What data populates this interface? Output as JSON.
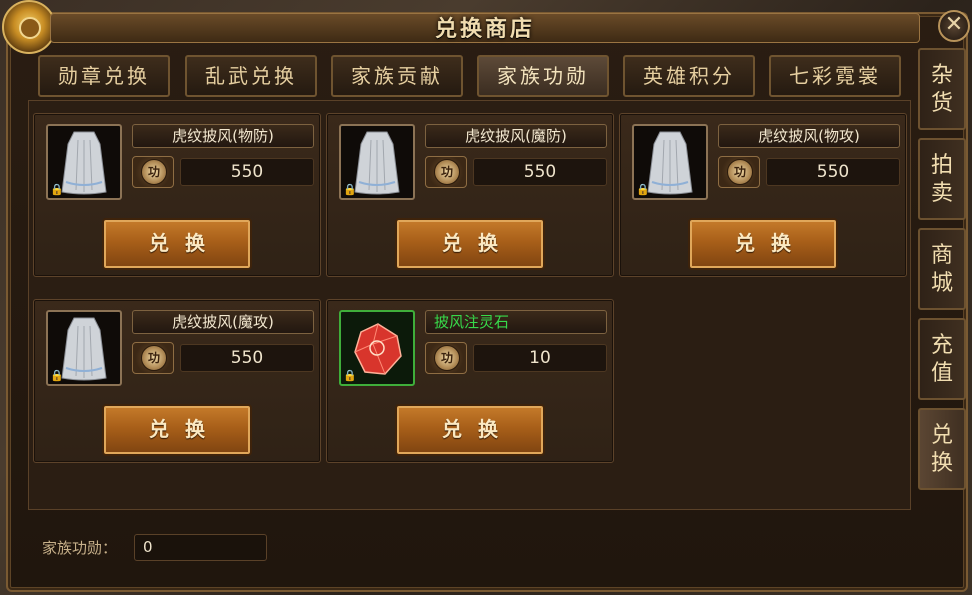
{
  "window": {
    "title": "兑换商店"
  },
  "tabs": [
    {
      "label": "勋章兑换"
    },
    {
      "label": "乱武兑换"
    },
    {
      "label": "家族贡献"
    },
    {
      "label": "家族功勋",
      "active": true
    },
    {
      "label": "英雄积分"
    },
    {
      "label": "七彩霓裳"
    }
  ],
  "side_tabs": [
    {
      "label_top": "杂",
      "label_bottom": "货"
    },
    {
      "label_top": "拍",
      "label_bottom": "卖"
    },
    {
      "label_top": "商",
      "label_bottom": "城"
    },
    {
      "label_top": "充",
      "label_bottom": "值"
    },
    {
      "label_top": "兑",
      "label_bottom": "换",
      "active": true
    }
  ],
  "items": [
    {
      "name": "虎纹披风(物防)",
      "price": "550",
      "icon": "cape-icon",
      "currency_glyph": "功",
      "button": "兑换"
    },
    {
      "name": "虎纹披风(魔防)",
      "price": "550",
      "icon": "cape-icon",
      "currency_glyph": "功",
      "button": "兑换"
    },
    {
      "name": "虎纹披风(物攻)",
      "price": "550",
      "icon": "cape-icon",
      "currency_glyph": "功",
      "button": "兑换"
    },
    {
      "name": "虎纹披风(魔攻)",
      "price": "550",
      "icon": "cape-icon",
      "currency_glyph": "功",
      "button": "兑换"
    },
    {
      "name": "披风注灵石",
      "price": "10",
      "icon": "spirit-gem-icon",
      "currency_glyph": "功",
      "button": "兑换",
      "name_color": "#37d94a"
    }
  ],
  "footer": {
    "label": "家族功勋：",
    "value": "0"
  },
  "colors": {
    "accent_gold": "#c67c2b",
    "item_name_green": "#37d94a",
    "lock_blue": "#4aa3ff"
  }
}
